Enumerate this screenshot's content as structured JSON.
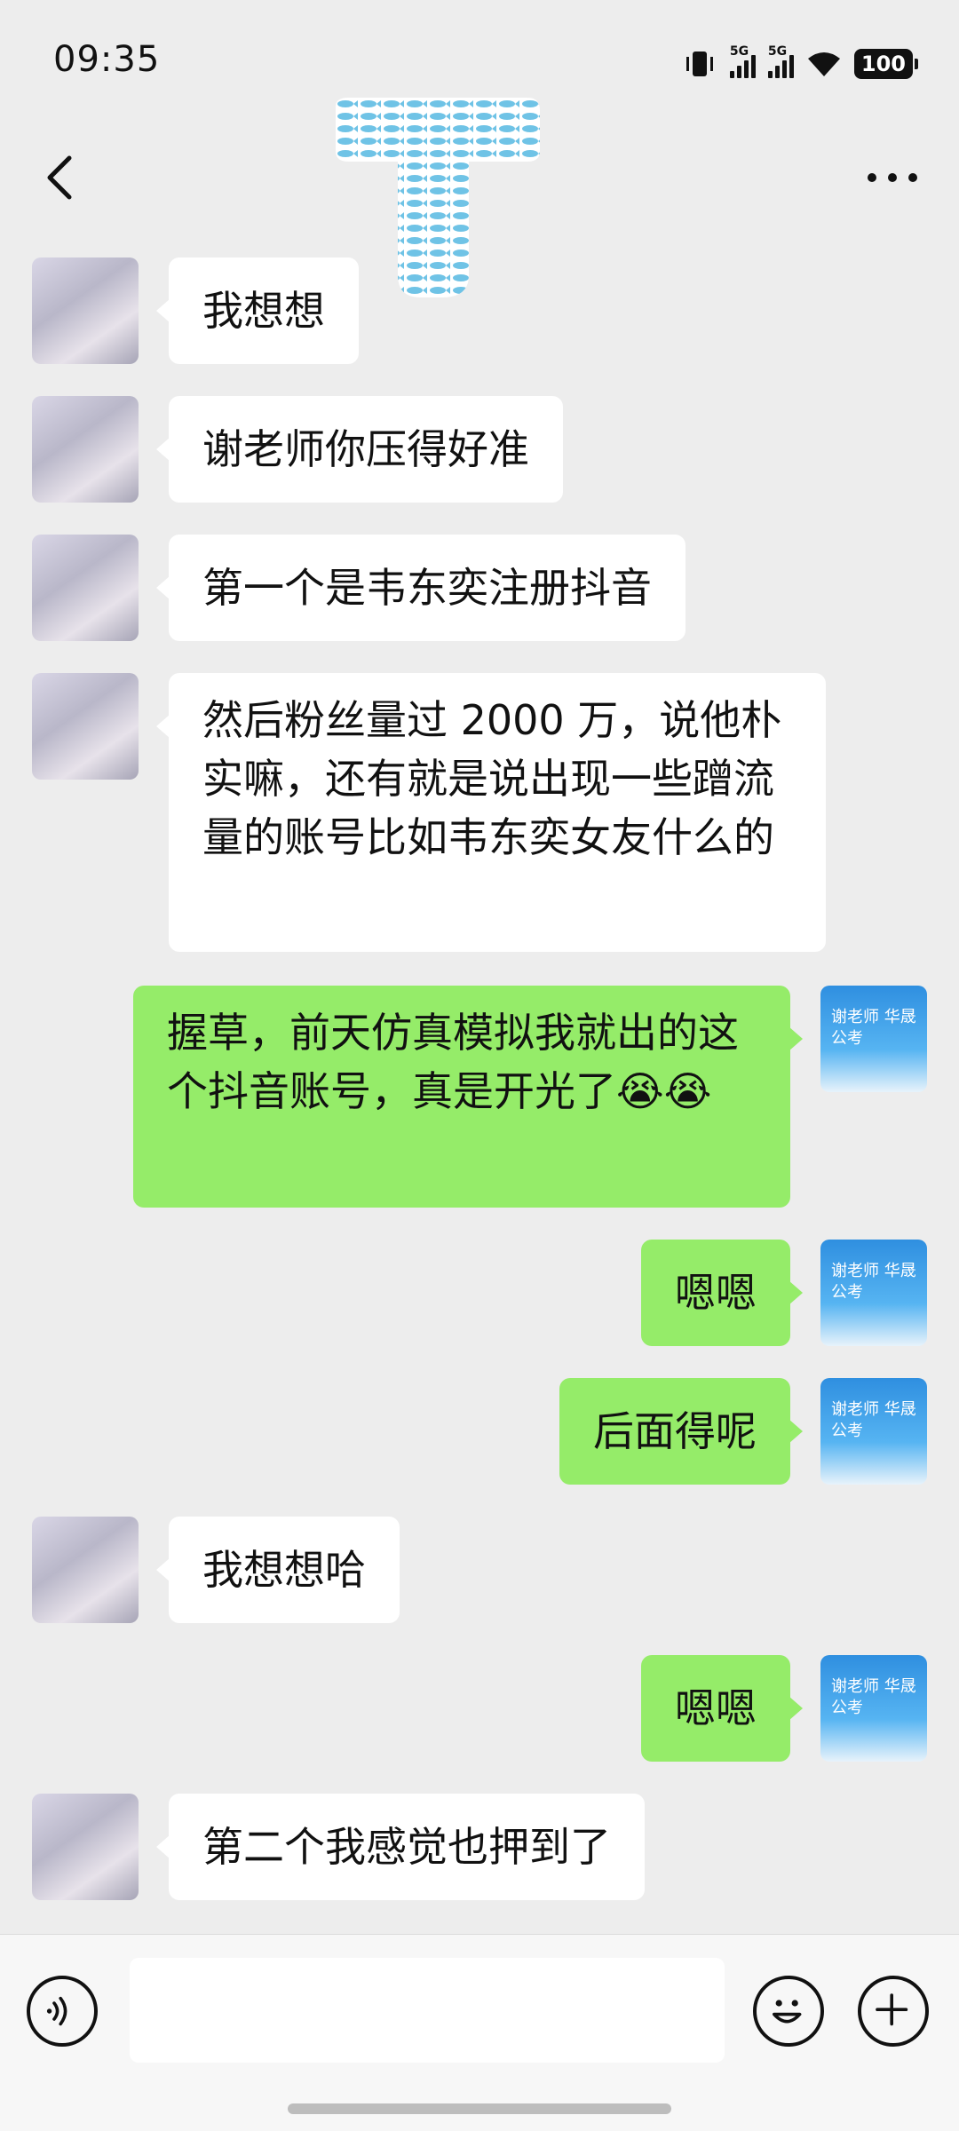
{
  "status": {
    "time": "09:35",
    "net1": "5G",
    "net2": "5G",
    "battery": "100"
  },
  "icons": {
    "back": "chevron-left-icon",
    "more": "more-horizontal-icon",
    "voice": "voice-icon",
    "emoji": "emoji-icon",
    "add": "plus-icon"
  },
  "colors": {
    "background": "#ededed",
    "incoming_bubble": "#ffffff",
    "outgoing_bubble": "#95ec69"
  },
  "messages": [
    {
      "side": "in",
      "text": "我想想"
    },
    {
      "side": "in",
      "text": "谢老师你压得好准"
    },
    {
      "side": "in",
      "text": "第一个是韦东奕注册抖音"
    },
    {
      "side": "in",
      "text": "然后粉丝量过 2000 万，说他朴实嘛，还有就是说出现一些蹭流量的账号比如韦东奕女友什么的"
    },
    {
      "side": "out",
      "text": "握草，前天仿真模拟我就出的这个抖音账号，真是开光了😭😭"
    },
    {
      "side": "out",
      "text": "嗯嗯"
    },
    {
      "side": "out",
      "text": "后面得呢"
    },
    {
      "side": "in",
      "text": "我想想哈"
    },
    {
      "side": "out",
      "text": "嗯嗯"
    },
    {
      "side": "in",
      "text": "第二个我感觉也押到了"
    }
  ],
  "outgoing_avatar_text": "谢老师 华晟公考"
}
